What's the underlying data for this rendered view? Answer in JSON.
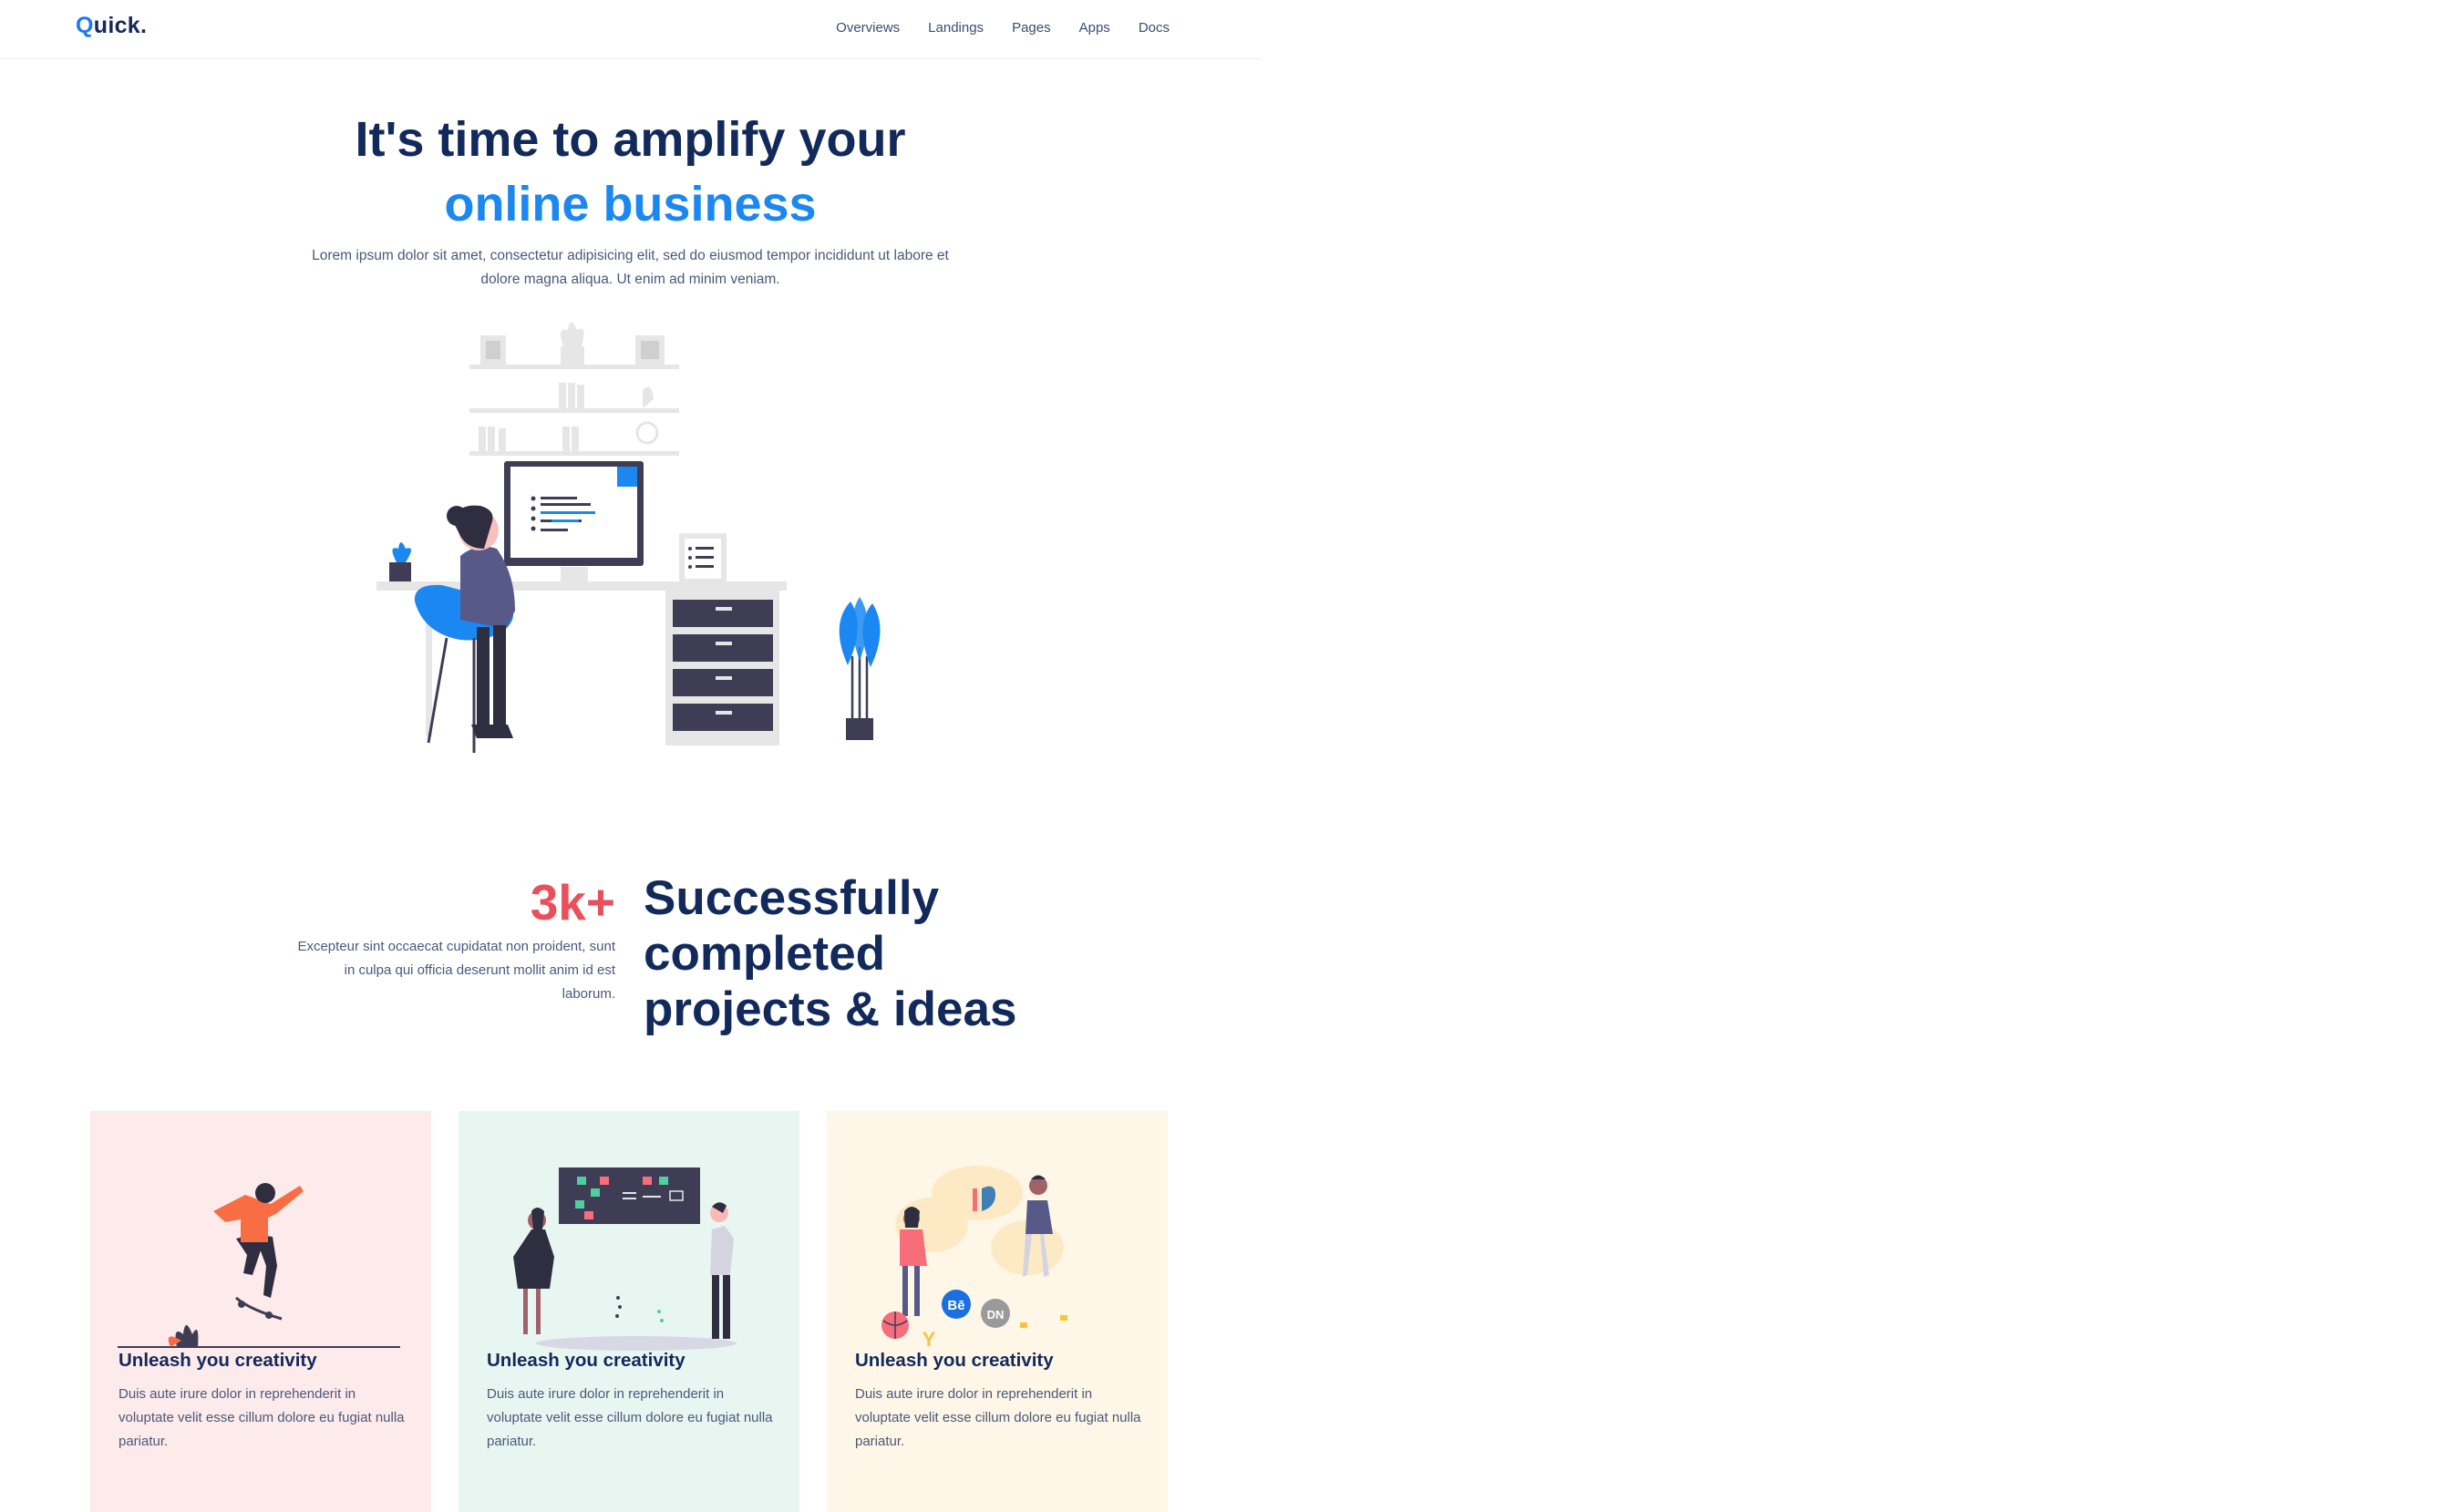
{
  "nav": {
    "logo_q": "Q",
    "logo_rest": "uick.",
    "links": [
      "Overviews",
      "Landings",
      "Pages",
      "Apps",
      "Docs"
    ]
  },
  "hero": {
    "title_line1": "It's time to amplify your",
    "title_line2": "online business",
    "lead": "Lorem ipsum dolor sit amet, consectetur adipisicing elit, sed do eiusmod tempor incididunt ut labore et dolore magna aliqua. Ut enim ad minim veniam."
  },
  "stats": {
    "number": "3k+",
    "text": "Excepteur sint occaecat cupidatat non proident, sunt in culpa qui officia deserunt mollit anim id est laborum.",
    "heading_line1": "Successfully",
    "heading_line2": "completed",
    "heading_line3": "projects & ideas"
  },
  "cards": [
    {
      "title": "Unleash you creativity",
      "text": "Duis aute irure dolor in reprehenderit in voluptate velit esse cillum dolore eu fugiat nulla pariatur."
    },
    {
      "title": "Unleash you creativity",
      "text": "Duis aute irure dolor in reprehenderit in voluptate velit esse cillum dolore eu fugiat nulla pariatur."
    },
    {
      "title": "Unleash you creativity",
      "text": "Duis aute irure dolor in reprehenderit in voluptate velit esse cillum dolore eu fugiat nulla pariatur."
    }
  ],
  "card3_icon_text": {
    "behance": "Bē",
    "dn": "DN",
    "y": "Y"
  },
  "colors": {
    "primary": "#1b88f1",
    "heading": "#12295b",
    "accent_red": "#e9505a",
    "card_pink": "#fdeaea",
    "card_mint": "#e8f6f1",
    "card_cream": "#fef6e6"
  },
  "icons": [
    "desk-illustration",
    "skater-illustration",
    "board-meeting-illustration",
    "social-creatives-illustration"
  ]
}
